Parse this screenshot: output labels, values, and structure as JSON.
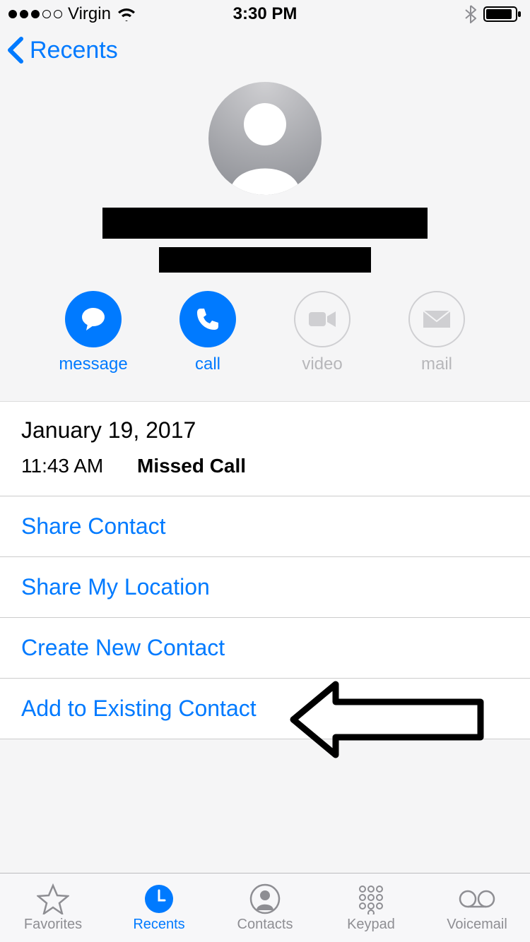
{
  "status": {
    "carrier": "Virgin",
    "time": "3:30 PM"
  },
  "nav": {
    "back_label": "Recents"
  },
  "actions": {
    "message": "message",
    "call": "call",
    "video": "video",
    "mail": "mail"
  },
  "log": {
    "date": "January 19, 2017",
    "time": "11:43 AM",
    "type": "Missed Call"
  },
  "rows": {
    "share_contact": "Share Contact",
    "share_location": "Share My Location",
    "create_contact": "Create New Contact",
    "add_existing": "Add to Existing Contact"
  },
  "tabs": {
    "favorites": "Favorites",
    "recents": "Recents",
    "contacts": "Contacts",
    "keypad": "Keypad",
    "voicemail": "Voicemail"
  }
}
